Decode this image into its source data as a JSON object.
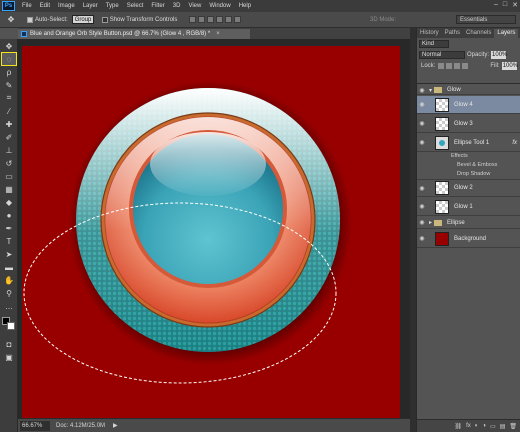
{
  "menubar": {
    "logo": "Ps",
    "items": [
      "File",
      "Edit",
      "Image",
      "Layer",
      "Type",
      "Select",
      "Filter",
      "3D",
      "View",
      "Window",
      "Help"
    ],
    "win_min": "–",
    "win_max": "□",
    "win_close": "✕"
  },
  "options": {
    "auto_select_label": "Auto-Select:",
    "auto_select_value": "Group",
    "show_transform_label": "Show Transform Controls",
    "mode_3d_label": "3D Mode:",
    "workspace": "Essentials"
  },
  "document": {
    "tab_title": "Blue and Orange Orb Style Button.psd @ 66.7% (Glow 4 , RGB/8) *",
    "tab_close": "×",
    "canvas_color": "#980000"
  },
  "status": {
    "zoom": "66.67%",
    "doc_info": "Doc: 4.12M/25.0M",
    "arrow": "▶"
  },
  "panels": {
    "tabs": [
      "History",
      "Paths",
      "Channels",
      "Layers"
    ],
    "active_tab": "Layers",
    "filter_kind": "Kind",
    "blend_mode": "Normal",
    "opacity_label": "Opacity:",
    "opacity_value": "100%",
    "lock_label": "Lock:",
    "fill_label": "Fill:",
    "fill_value": "100%"
  },
  "layers": {
    "group_glow": "Glow",
    "glow4": "Glow 4",
    "glow3": "Glow 3",
    "ellipse_tool": "Ellipse Tool 1",
    "effects": "Effects",
    "bevel": "Bevel & Emboss",
    "drop_shadow": "Drop Shadow",
    "glow2": "Glow 2",
    "glow1": "Glow 1",
    "group_ellipse": "Ellipse",
    "background": "Background",
    "fx_badge": "fx",
    "footer_icons": [
      "⛓",
      "fx",
      "◐",
      "◑",
      "▭",
      "▤",
      "🗑"
    ]
  },
  "colors": {
    "canvas_red": "#980000",
    "teal": "#1f8a8c",
    "orange": "#e35a32",
    "cyan": "#4ab5c6",
    "accent_highlight": "#f4e21a"
  }
}
